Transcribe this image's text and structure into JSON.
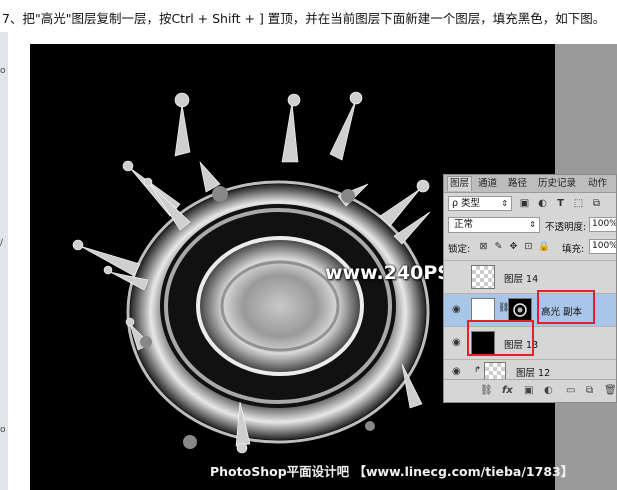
{
  "caption": "7、把\"高光\"图层复制一层，按Ctrl + Shift + ] 置顶，并在当前图层下面新建一个图层，填充黑色，如下图。",
  "left_strip_marks": [
    "o",
    "/",
    "o"
  ],
  "watermark": "www.240PS.com",
  "footer": "PhotoShop平面设计吧 【www.linecg.com/tieba/1783】",
  "panel": {
    "tabs": [
      "图层",
      "通道",
      "路径",
      "历史记录",
      "动作"
    ],
    "kind_label": "ρ 类型",
    "filter_icons": [
      "image-filter-icon",
      "adjustment-filter-icon",
      "type-filter-icon",
      "shape-filter-icon",
      "smart-object-filter-icon"
    ],
    "blend_mode": "正常",
    "opacity_label": "不透明度:",
    "opacity_value": "100%",
    "lock_label": "锁定:",
    "fill_label": "填充:",
    "fill_value": "100%",
    "layers": [
      {
        "name": "图层 14",
        "thumb": "transparent",
        "visible": false,
        "selected": false
      },
      {
        "name": "高光 副本",
        "thumb": "white-with-mask",
        "visible": true,
        "selected": true
      },
      {
        "name": "图层 13",
        "thumb": "black",
        "visible": true,
        "selected": false
      },
      {
        "name": "图层 12",
        "thumb": "transparent",
        "visible": true,
        "selected": false
      }
    ]
  }
}
